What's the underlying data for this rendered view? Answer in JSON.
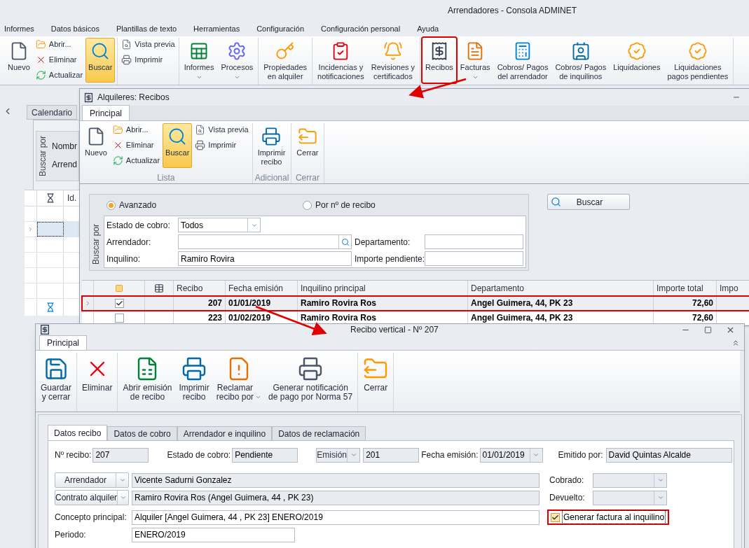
{
  "main": {
    "title": "Arrendadores - Consola ADMINET",
    "menu": [
      "Informes",
      "Datos básicos",
      "Plantillas de texto",
      "Herramientas",
      "Configuración",
      "Configuración personal",
      "Ayuda"
    ],
    "ribbon": [
      {
        "items": [
          {
            "kind": "large",
            "label": "Nuevo",
            "active": false,
            "dropdown": false,
            "highlighted": false
          },
          {
            "kind": "stack",
            "items": [
              {
                "label": "Abrir..."
              },
              {
                "label": "Eliminar"
              },
              {
                "label": "Actualizar"
              }
            ]
          },
          {
            "kind": "large",
            "label": "Buscar",
            "active": true,
            "dropdown": false,
            "highlighted": false
          }
        ]
      },
      {
        "items": [
          {
            "kind": "stack",
            "items": [
              {
                "label": "Vista previa"
              },
              {
                "label": "Imprimir"
              }
            ]
          }
        ]
      },
      {
        "items": [
          {
            "kind": "large",
            "label": "Informes",
            "active": false,
            "dropdown": true,
            "highlighted": false
          },
          {
            "kind": "large",
            "label": "Procesos",
            "active": false,
            "dropdown": true,
            "highlighted": false
          }
        ]
      },
      {
        "items": [
          {
            "kind": "large",
            "label": "Propiedades\nen alquiler",
            "active": false,
            "dropdown": false,
            "highlighted": false
          }
        ]
      },
      {
        "items": [
          {
            "kind": "large",
            "label": "Incidencias y\nnotificaciones",
            "active": false,
            "dropdown": false,
            "highlighted": false
          },
          {
            "kind": "large",
            "label": "Revisiones y\ncertificados",
            "active": false,
            "dropdown": false,
            "highlighted": false
          }
        ]
      },
      {
        "items": [
          {
            "kind": "large",
            "label": "Recibos",
            "active": false,
            "dropdown": false,
            "highlighted": true
          },
          {
            "kind": "large",
            "label": "Facturas",
            "active": false,
            "dropdown": true,
            "highlighted": false
          },
          {
            "kind": "large",
            "label": "Cobros/ Pagos\ndel arrendador",
            "active": false,
            "dropdown": false,
            "highlighted": false
          },
          {
            "kind": "large",
            "label": "Cobros/ Pagos\nde inquilinos",
            "active": false,
            "dropdown": false,
            "highlighted": false
          },
          {
            "kind": "large",
            "label": "Liquidaciones",
            "active": false,
            "dropdown": false,
            "highlighted": false
          },
          {
            "kind": "large",
            "label": "Liquidaciones\npagos pendientes",
            "active": false,
            "dropdown": false,
            "highlighted": false
          }
        ]
      }
    ],
    "left_panel": {
      "tab": "Calendario",
      "search_label": "Buscar por",
      "fields": [
        "Nombr",
        "Arrend"
      ],
      "column": "Id."
    }
  },
  "list_window": {
    "title": "Alquileres: Recibos",
    "tab": "Principal",
    "ribbon": [
      {
        "caption": "Lista",
        "items": [
          {
            "kind": "large",
            "label": "Nuevo",
            "active": false,
            "dropdown": false,
            "highlighted": false
          },
          {
            "kind": "stack",
            "items": [
              {
                "label": "Abrir..."
              },
              {
                "label": "Eliminar"
              },
              {
                "label": "Actualizar"
              }
            ]
          },
          {
            "kind": "large",
            "label": "Buscar",
            "active": true,
            "dropdown": false,
            "highlighted": false
          },
          {
            "kind": "stack",
            "items": [
              {
                "label": "Vista previa"
              },
              {
                "label": "Imprimir"
              }
            ]
          }
        ]
      },
      {
        "caption": "Adicional",
        "items": [
          {
            "kind": "large",
            "label": "Imprimir\nrecibo",
            "active": false,
            "dropdown": false,
            "highlighted": false
          }
        ]
      },
      {
        "caption": "Cerrar",
        "items": [
          {
            "kind": "large",
            "label": "Cerrar",
            "active": false,
            "dropdown": false,
            "highlighted": false
          }
        ]
      }
    ],
    "search": {
      "label": "Buscar por",
      "modes": [
        {
          "label": "Avanzado",
          "selected": true
        },
        {
          "label": "Por nº de recibo",
          "selected": false
        }
      ],
      "fields": [
        {
          "kind": "dropdown",
          "label": "Estado de cobro:",
          "value": "Todos"
        },
        {
          "kind": "lookup",
          "label": "Arrendador:"
        },
        {
          "kind": "text",
          "label": "Inquilino:",
          "value": "Ramiro Rovira"
        }
      ],
      "right_fields": [
        {
          "label": "Departamento:"
        },
        {
          "label": "Importe pendiente:"
        }
      ],
      "button": "Buscar"
    },
    "table": {
      "columns": [
        "Recibo",
        "Fecha emisión",
        "Inquilino principal",
        "Departamento",
        "Importe total",
        "Impo"
      ],
      "rows": [
        {
          "current": true,
          "checked": true,
          "highlighted": true,
          "cells": [
            "207",
            "01/01/2019",
            "Ramiro Rovira Ros",
            "Angel Guimera, 44, PK 23",
            "72,60"
          ]
        },
        {
          "current": false,
          "checked": false,
          "highlighted": false,
          "cells": [
            "223",
            "01/02/2019",
            "Ramiro Rovira Ros",
            "Angel Guimera, 44, PK 23",
            "72,60"
          ]
        }
      ]
    }
  },
  "receipt_window": {
    "title": "Recibo vertical - Nº 207",
    "tab": "Principal",
    "ribbon": [
      {
        "items": [
          {
            "kind": "large",
            "label": "Guardar\ny cerrar",
            "active": false,
            "dropdown": false,
            "highlighted": false
          }
        ]
      },
      {
        "items": [
          {
            "kind": "large",
            "label": "Eliminar",
            "active": false,
            "dropdown": false,
            "highlighted": false
          }
        ]
      },
      {
        "items": [
          {
            "kind": "large",
            "label": "Abrir emisión\nde recibo",
            "active": false,
            "dropdown": false,
            "highlighted": false
          },
          {
            "kind": "large",
            "label": "Imprimir\nrecibo",
            "active": false,
            "dropdown": false,
            "highlighted": false
          },
          {
            "kind": "large",
            "label": "Reclamar\nrecibo por",
            "active": false,
            "dropdown": true,
            "highlighted": false
          },
          {
            "kind": "large",
            "label": "Generar notificación\nde pago por Norma 57",
            "active": false,
            "dropdown": false,
            "highlighted": false
          }
        ]
      },
      {
        "items": [
          {
            "kind": "large",
            "label": "Cerrar",
            "active": false,
            "dropdown": false,
            "highlighted": false
          }
        ]
      }
    ],
    "tabs": [
      {
        "label": "Datos recibo",
        "selected": true
      },
      {
        "label": "Datos de cobro",
        "selected": false
      },
      {
        "label": "Arrendador e inquilino",
        "selected": false
      },
      {
        "label": "Datos de reclamación",
        "selected": false
      }
    ],
    "form": {
      "receipt_no": {
        "label": "Nº recibo:",
        "value": "207",
        "readonly": true
      },
      "status": {
        "label": "Estado de cobro:",
        "value": "Pendiente",
        "readonly": true
      },
      "issue": {
        "button": "Emisión",
        "value": "201",
        "readonly": true
      },
      "issue_date": {
        "label": "Fecha emisión:",
        "value": "01/01/2019",
        "readonly": true
      },
      "issued_by": {
        "label": "Emitido por:",
        "value": "David Quintas Alcalde",
        "readonly": true
      },
      "landlord": {
        "button": "Arrendador",
        "value": "Vicente Sadurni Gonzalez",
        "readonly": true
      },
      "contract": {
        "button": "Contrato alquiler",
        "value": "Ramiro Rovira Ros (Angel Guimera, 44 , PK 23)",
        "readonly": true
      },
      "collected": {
        "label": "Cobrado:",
        "readonly": true
      },
      "returned": {
        "label": "Devuelto:",
        "readonly": true
      },
      "concept": {
        "label": "Concepto principal:",
        "value": "Alquiler [Angel Guimera, 44 , PK 23] ENERO/2019",
        "readonly": false
      },
      "invoice": {
        "label": "Generar factura al inquilino",
        "checked": true,
        "highlighted": true
      },
      "period": {
        "label": "Periodo:",
        "value": "ENERO/2019",
        "readonly": false
      }
    }
  }
}
